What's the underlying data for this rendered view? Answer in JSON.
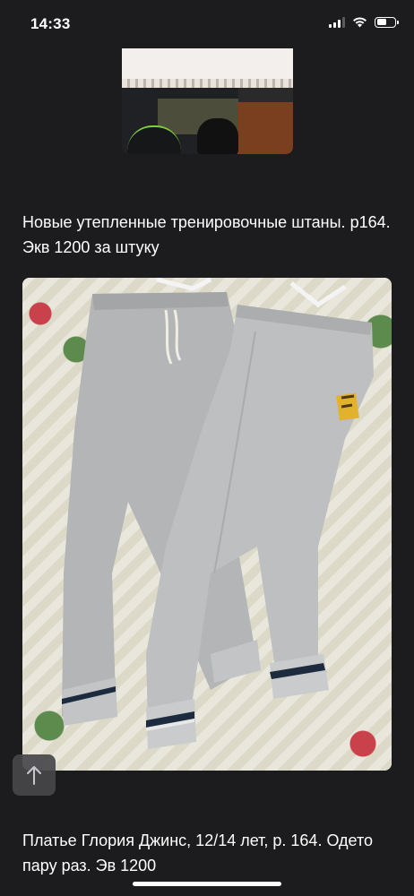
{
  "status_bar": {
    "time": "14:33",
    "signal_bars": 4,
    "signal_bars_active": 3,
    "battery_level": 0.55,
    "icons": [
      "signal-icon",
      "wifi-icon",
      "battery-icon"
    ]
  },
  "posts": [
    {
      "caption": "Новые утепленные тренировочные штаны. р164. Экв 1200 за штуку"
    },
    {
      "caption": "Платье Глория Джинс, 12/14 лет, р. 164. Одето пару раз. Эв 1200"
    }
  ],
  "controls": {
    "back_to_top_icon": "arrow-up-icon"
  },
  "colors": {
    "background": "#1c1c1e",
    "text": "#ffffff",
    "pants": "#b7b9bb",
    "cuff_stripe": "#1d2b3f",
    "logo_patch": "#e2b22b"
  }
}
